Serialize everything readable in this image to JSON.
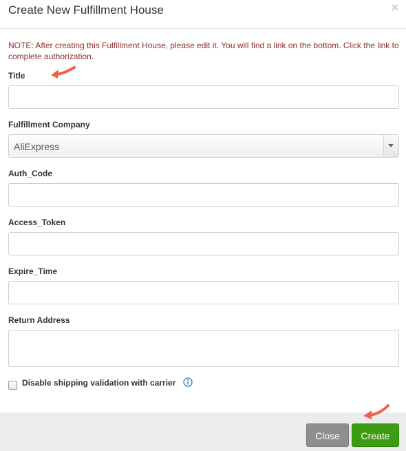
{
  "dialog": {
    "title": "Create New Fulfillment House",
    "close_symbol": "×"
  },
  "note": "NOTE: After creating this Fulfillment House, please edit it. You will find a link on the bottom. Click the link to complete authorization.",
  "form": {
    "title_label": "Title",
    "title_value": "",
    "company_label": "Fulfillment Company",
    "company_value": "AliExpress",
    "auth_code_label": "Auth_Code",
    "auth_code_value": "",
    "access_token_label": "Access_Token",
    "access_token_value": "",
    "expire_time_label": "Expire_Time",
    "expire_time_value": "",
    "return_address_label": "Return Address",
    "return_address_value": "",
    "disable_validation_label": "Disable shipping validation with carrier",
    "disable_validation_checked": false
  },
  "footer": {
    "close_label": "Close",
    "create_label": "Create"
  },
  "colors": {
    "note": "#8b2e2e",
    "create_button": "#3c9c12",
    "close_button": "#8e8e8e",
    "annotation_arrow": "#f0604a",
    "info_icon": "#2a7bbf"
  },
  "icons": [
    "close-icon",
    "chevron-down-icon",
    "info-icon",
    "annotation-arrow"
  ]
}
